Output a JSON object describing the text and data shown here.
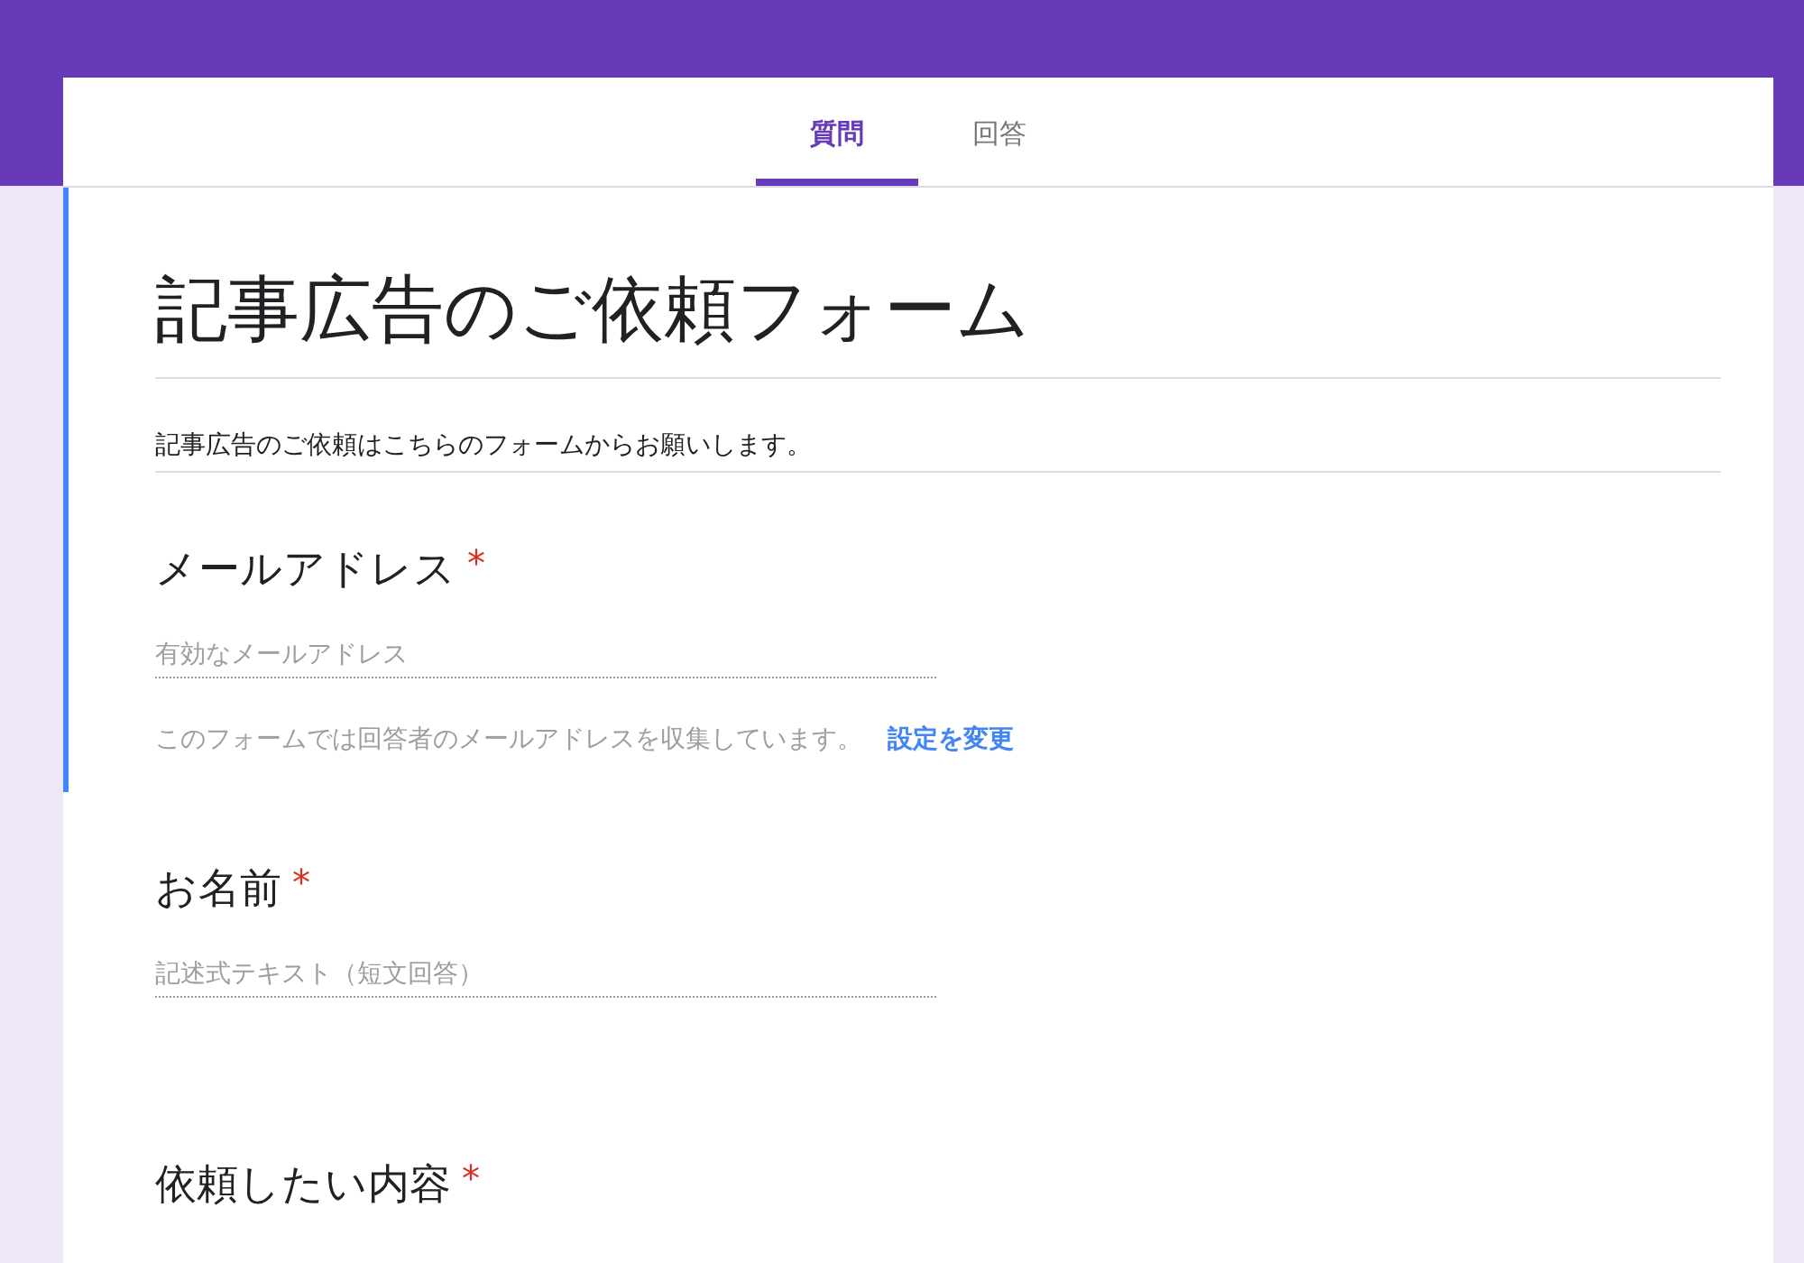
{
  "tabs": [
    {
      "label": "質問",
      "selected": true
    },
    {
      "label": "回答",
      "selected": false
    }
  ],
  "header": {
    "title": "記事広告のご依頼フォーム",
    "description": "記事広告のご依頼はこちらのフォームからお願いします。",
    "selected": true
  },
  "questions": [
    {
      "label": "メールアドレス",
      "required_mark": "*",
      "placeholder": "有効なメールアドレス",
      "note": "このフォームでは回答者のメールアドレスを収集しています。",
      "link": "設定を変更",
      "selected": true
    },
    {
      "label": "お名前",
      "required_mark": "*",
      "placeholder": "記述式テキスト（短文回答）",
      "selected": false
    },
    {
      "label": "依頼したい内容",
      "required_mark": "*",
      "selected": false
    }
  ]
}
